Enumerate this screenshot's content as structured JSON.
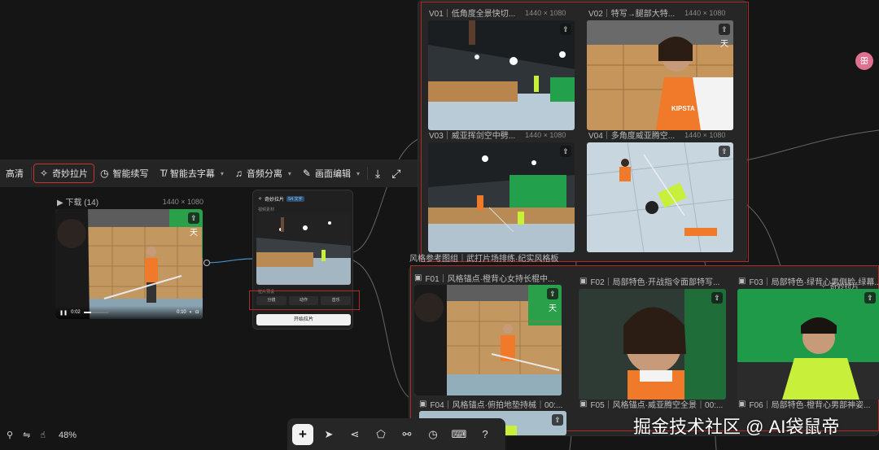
{
  "toolbar": {
    "items": [
      {
        "label": "高清",
        "icon": "hd-icon",
        "chevron": false
      },
      {
        "label": "奇妙拉片",
        "icon": "magic-icon",
        "chevron": false,
        "highlighted": true
      },
      {
        "label": "智能续写",
        "icon": "clock-icon",
        "chevron": false
      },
      {
        "label": "智能去字幕",
        "icon": "text-strike-icon",
        "chevron": true
      },
      {
        "label": "音频分离",
        "icon": "music-icon",
        "chevron": true
      },
      {
        "label": "画面编辑",
        "icon": "edit-icon",
        "chevron": true
      }
    ],
    "download_icon": "download-icon",
    "expand_icon": "expand-icon"
  },
  "download_node": {
    "label": "▶ 下载 (14)",
    "dims": "1440 × 1080",
    "time_current": "0:02",
    "time_total": "0:10"
  },
  "qimiao_card": {
    "title": "奇妙拉片",
    "badge": "S4 文字",
    "source_label": "视频素材",
    "mode_label": "拉片预设",
    "options": [
      "分镜",
      "动作",
      "音乐"
    ],
    "start_label": "开始拉片"
  },
  "video_group": [
    {
      "label": "V01｜低角度全景快切...",
      "dims": "1440 × 1080"
    },
    {
      "label": "V02｜特写→腿部大特...",
      "dims": "1440 × 1080"
    },
    {
      "label": "V03｜威亚挥剑空中劈...",
      "dims": "1440 × 1080"
    },
    {
      "label": "V04｜多角度威亚腾空...",
      "dims": "1440 × 1080"
    }
  ],
  "ref_group": {
    "title": "风格参考图组｜武打片场排练·纪实风格板",
    "items": [
      {
        "label": "F01｜风格锚点·橙背心女持长棍中..."
      },
      {
        "label": "F02｜局部特色·开战指令面部特写..."
      },
      {
        "label": "F03｜局部特色·绿背心男侧脸·绿幕..."
      },
      {
        "label": "F04｜风格锚点·俯拍地垫持械｜00:..."
      },
      {
        "label": "F05｜风格锚点·威亚腾空全景｜00:..."
      },
      {
        "label": "F06｜局部特色·橙背心男部神姿..."
      }
    ],
    "small_label": "奇妙拉片"
  },
  "scene_text": {
    "tian": "天",
    "kipsta": "KIPSTA"
  },
  "status": {
    "zoom": "48%"
  },
  "bottom_tools": [
    "plus-icon",
    "pointer-icon",
    "share-icon",
    "shape-icon",
    "link-icon",
    "clock-icon",
    "keyboard-icon",
    "help-icon"
  ],
  "watermark": "掘金技术社区 @ AI袋鼠帝",
  "avatar_glyph": "ꕥ",
  "colors": {
    "highlight": "#c83232",
    "vest_orange": "#f07a2a",
    "vest_green": "#c8f03a",
    "greenscreen": "#21a24a",
    "box_brown": "#c8955a"
  }
}
